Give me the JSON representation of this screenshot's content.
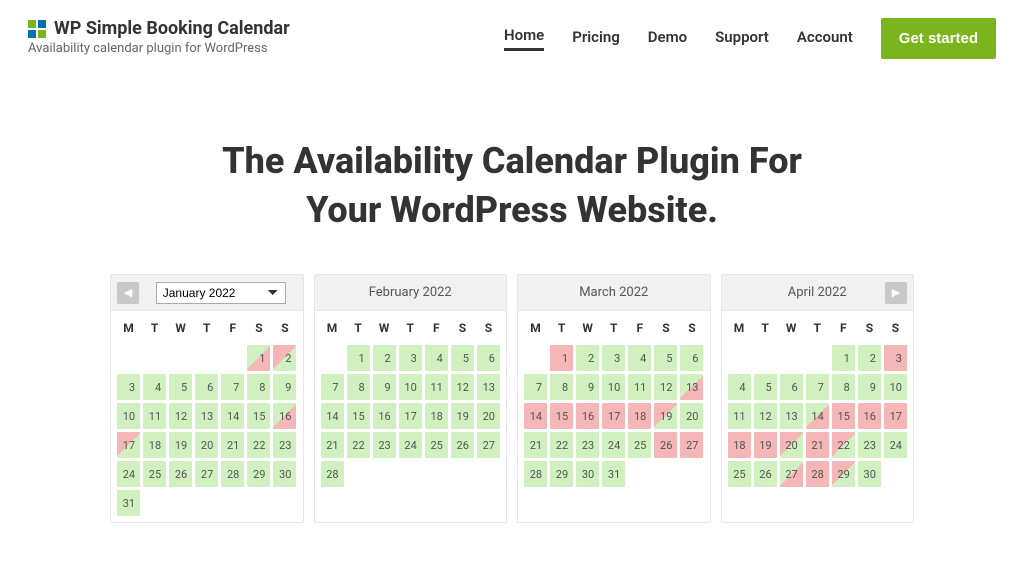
{
  "brand": {
    "title": "WP Simple Booking Calendar",
    "subtitle": "Availability calendar plugin for WordPress"
  },
  "nav": {
    "items": [
      "Home",
      "Pricing",
      "Demo",
      "Support",
      "Account"
    ],
    "active": "Home",
    "cta": "Get started"
  },
  "hero": {
    "line1": "The Availability Calendar Plugin For",
    "line2": "Your WordPress Website."
  },
  "dow": [
    "M",
    "T",
    "W",
    "T",
    "F",
    "S",
    "S"
  ],
  "month_selector_value": "January 2022",
  "calendars": [
    {
      "title": "January 2022",
      "has_prev": true,
      "has_selector": true,
      "offset": 5,
      "days": [
        {
          "n": 1,
          "s": "half-in"
        },
        {
          "n": 2,
          "s": "half-out"
        },
        {
          "n": 3,
          "s": "avail"
        },
        {
          "n": 4,
          "s": "avail"
        },
        {
          "n": 5,
          "s": "avail"
        },
        {
          "n": 6,
          "s": "avail"
        },
        {
          "n": 7,
          "s": "avail"
        },
        {
          "n": 8,
          "s": "avail"
        },
        {
          "n": 9,
          "s": "avail"
        },
        {
          "n": 10,
          "s": "avail"
        },
        {
          "n": 11,
          "s": "avail"
        },
        {
          "n": 12,
          "s": "avail"
        },
        {
          "n": 13,
          "s": "avail"
        },
        {
          "n": 14,
          "s": "avail"
        },
        {
          "n": 15,
          "s": "avail"
        },
        {
          "n": 16,
          "s": "half-in"
        },
        {
          "n": 17,
          "s": "half-out"
        },
        {
          "n": 18,
          "s": "avail"
        },
        {
          "n": 19,
          "s": "avail"
        },
        {
          "n": 20,
          "s": "avail"
        },
        {
          "n": 21,
          "s": "avail"
        },
        {
          "n": 22,
          "s": "avail"
        },
        {
          "n": 23,
          "s": "avail"
        },
        {
          "n": 24,
          "s": "avail"
        },
        {
          "n": 25,
          "s": "avail"
        },
        {
          "n": 26,
          "s": "avail"
        },
        {
          "n": 27,
          "s": "avail"
        },
        {
          "n": 28,
          "s": "avail"
        },
        {
          "n": 29,
          "s": "avail"
        },
        {
          "n": 30,
          "s": "avail"
        },
        {
          "n": 31,
          "s": "avail"
        }
      ]
    },
    {
      "title": "February 2022",
      "offset": 1,
      "days": [
        {
          "n": 1,
          "s": "avail"
        },
        {
          "n": 2,
          "s": "avail"
        },
        {
          "n": 3,
          "s": "avail"
        },
        {
          "n": 4,
          "s": "avail"
        },
        {
          "n": 5,
          "s": "avail"
        },
        {
          "n": 6,
          "s": "avail"
        },
        {
          "n": 7,
          "s": "avail"
        },
        {
          "n": 8,
          "s": "avail"
        },
        {
          "n": 9,
          "s": "avail"
        },
        {
          "n": 10,
          "s": "avail"
        },
        {
          "n": 11,
          "s": "avail"
        },
        {
          "n": 12,
          "s": "avail"
        },
        {
          "n": 13,
          "s": "avail"
        },
        {
          "n": 14,
          "s": "avail"
        },
        {
          "n": 15,
          "s": "avail"
        },
        {
          "n": 16,
          "s": "avail"
        },
        {
          "n": 17,
          "s": "avail"
        },
        {
          "n": 18,
          "s": "avail"
        },
        {
          "n": 19,
          "s": "avail"
        },
        {
          "n": 20,
          "s": "avail"
        },
        {
          "n": 21,
          "s": "avail"
        },
        {
          "n": 22,
          "s": "avail"
        },
        {
          "n": 23,
          "s": "avail"
        },
        {
          "n": 24,
          "s": "avail"
        },
        {
          "n": 25,
          "s": "avail"
        },
        {
          "n": 26,
          "s": "avail"
        },
        {
          "n": 27,
          "s": "avail"
        },
        {
          "n": 28,
          "s": "avail"
        }
      ]
    },
    {
      "title": "March 2022",
      "offset": 1,
      "days": [
        {
          "n": 1,
          "s": "booked"
        },
        {
          "n": 2,
          "s": "avail"
        },
        {
          "n": 3,
          "s": "avail"
        },
        {
          "n": 4,
          "s": "avail"
        },
        {
          "n": 5,
          "s": "avail"
        },
        {
          "n": 6,
          "s": "avail"
        },
        {
          "n": 7,
          "s": "avail"
        },
        {
          "n": 8,
          "s": "avail"
        },
        {
          "n": 9,
          "s": "avail"
        },
        {
          "n": 10,
          "s": "avail"
        },
        {
          "n": 11,
          "s": "avail"
        },
        {
          "n": 12,
          "s": "avail"
        },
        {
          "n": 13,
          "s": "half-in"
        },
        {
          "n": 14,
          "s": "booked"
        },
        {
          "n": 15,
          "s": "booked"
        },
        {
          "n": 16,
          "s": "booked"
        },
        {
          "n": 17,
          "s": "booked"
        },
        {
          "n": 18,
          "s": "booked"
        },
        {
          "n": 19,
          "s": "half-out"
        },
        {
          "n": 20,
          "s": "avail"
        },
        {
          "n": 21,
          "s": "avail"
        },
        {
          "n": 22,
          "s": "avail"
        },
        {
          "n": 23,
          "s": "avail"
        },
        {
          "n": 24,
          "s": "avail"
        },
        {
          "n": 25,
          "s": "avail"
        },
        {
          "n": 26,
          "s": "booked"
        },
        {
          "n": 27,
          "s": "booked"
        },
        {
          "n": 28,
          "s": "avail"
        },
        {
          "n": 29,
          "s": "avail"
        },
        {
          "n": 30,
          "s": "avail"
        },
        {
          "n": 31,
          "s": "avail"
        }
      ]
    },
    {
      "title": "April 2022",
      "has_next": true,
      "offset": 4,
      "days": [
        {
          "n": 1,
          "s": "avail"
        },
        {
          "n": 2,
          "s": "avail"
        },
        {
          "n": 3,
          "s": "booked"
        },
        {
          "n": 4,
          "s": "avail"
        },
        {
          "n": 5,
          "s": "avail"
        },
        {
          "n": 6,
          "s": "avail"
        },
        {
          "n": 7,
          "s": "avail"
        },
        {
          "n": 8,
          "s": "avail"
        },
        {
          "n": 9,
          "s": "avail"
        },
        {
          "n": 10,
          "s": "avail"
        },
        {
          "n": 11,
          "s": "avail"
        },
        {
          "n": 12,
          "s": "avail"
        },
        {
          "n": 13,
          "s": "avail"
        },
        {
          "n": 14,
          "s": "half-in"
        },
        {
          "n": 15,
          "s": "booked"
        },
        {
          "n": 16,
          "s": "booked"
        },
        {
          "n": 17,
          "s": "booked"
        },
        {
          "n": 18,
          "s": "booked"
        },
        {
          "n": 19,
          "s": "booked"
        },
        {
          "n": 20,
          "s": "half-out"
        },
        {
          "n": 21,
          "s": "booked"
        },
        {
          "n": 22,
          "s": "half-out"
        },
        {
          "n": 23,
          "s": "avail"
        },
        {
          "n": 24,
          "s": "avail"
        },
        {
          "n": 25,
          "s": "avail"
        },
        {
          "n": 26,
          "s": "avail"
        },
        {
          "n": 27,
          "s": "half-in"
        },
        {
          "n": 28,
          "s": "booked"
        },
        {
          "n": 29,
          "s": "half-out"
        },
        {
          "n": 30,
          "s": "avail"
        }
      ]
    }
  ]
}
